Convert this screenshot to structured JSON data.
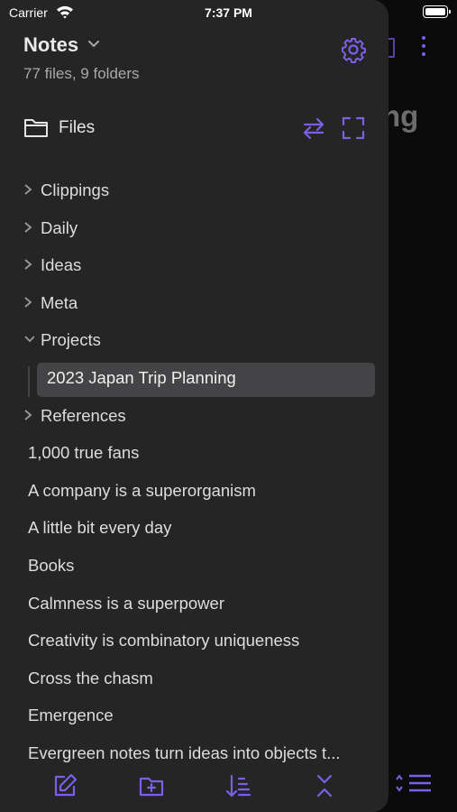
{
  "status_bar": {
    "carrier": "Carrier",
    "time": "7:37 PM"
  },
  "background_editor": {
    "title_fragment": "ng"
  },
  "drawer": {
    "vault_name": "Notes",
    "vault_summary": "77 files, 9 folders",
    "section_label": "Files",
    "tree": [
      {
        "label": "Clippings",
        "kind": "folder",
        "state": "collapsed"
      },
      {
        "label": "Daily",
        "kind": "folder",
        "state": "collapsed"
      },
      {
        "label": "Ideas",
        "kind": "folder",
        "state": "collapsed"
      },
      {
        "label": "Meta",
        "kind": "folder",
        "state": "collapsed"
      },
      {
        "label": "Projects",
        "kind": "folder",
        "state": "expanded"
      },
      {
        "label": "2023 Japan Trip Planning",
        "kind": "file",
        "state": "selected"
      },
      {
        "label": "References",
        "kind": "folder",
        "state": "collapsed"
      },
      {
        "label": "1,000 true fans",
        "kind": "file"
      },
      {
        "label": "A company is a superorganism",
        "kind": "file"
      },
      {
        "label": "A little bit every day",
        "kind": "file"
      },
      {
        "label": "Books",
        "kind": "file"
      },
      {
        "label": "Calmness is a superpower",
        "kind": "file"
      },
      {
        "label": "Creativity is combinatory uniqueness",
        "kind": "file"
      },
      {
        "label": "Cross the chasm",
        "kind": "file"
      },
      {
        "label": "Emergence",
        "kind": "file"
      },
      {
        "label": "Evergreen notes turn ideas into objects t...",
        "kind": "file"
      }
    ]
  },
  "icons": {
    "settings": "gear-icon",
    "folder": "folder-icon",
    "swap": "swap-arrows-icon",
    "expand": "fullscreen-icon",
    "new_note": "new-note-icon",
    "new_folder": "new-folder-icon",
    "sort": "sort-icon",
    "collapse": "collapse-all-icon"
  },
  "colors": {
    "accent": "#7b5fe6",
    "drawer_bg": "#252526",
    "selected_bg": "#444446",
    "text": "#dcddde",
    "muted_text": "#a9a9a9"
  }
}
